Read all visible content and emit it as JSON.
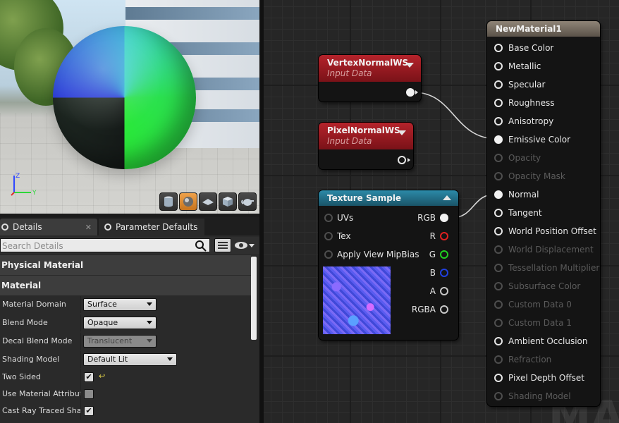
{
  "details_panel": {
    "tabs": [
      {
        "label": "Details"
      },
      {
        "label": "Parameter Defaults"
      }
    ],
    "search_placeholder": "Search Details",
    "categories": [
      "Physical Material",
      "Material"
    ],
    "properties": [
      {
        "label": "Material Domain",
        "type": "combo",
        "value": "Surface"
      },
      {
        "label": "Blend Mode",
        "type": "combo",
        "value": "Opaque"
      },
      {
        "label": "Decal Blend Mode",
        "type": "combo",
        "value": "Translucent",
        "disabled": true
      },
      {
        "label": "Shading Model",
        "type": "combo",
        "value": "Default Lit"
      },
      {
        "label": "Two Sided",
        "type": "checkbox",
        "checked": true
      },
      {
        "label": "Use Material Attributes",
        "type": "checkbox",
        "checked": false
      },
      {
        "label": "Cast Ray Traced Shadows",
        "type": "checkbox",
        "checked": true
      }
    ]
  },
  "viewport": {
    "axis_labels": {
      "z": "Z",
      "y": "Y"
    },
    "preview_buttons": [
      "cylinder-icon",
      "sphere-icon",
      "plane-icon",
      "cube-icon",
      "teapot-icon"
    ]
  },
  "graph": {
    "watermark": "MAT",
    "nodes": {
      "vertex_normal": {
        "title": "VertexNormalWS",
        "subtitle": "Input Data"
      },
      "pixel_normal": {
        "title": "PixelNormalWS",
        "subtitle": "Input Data"
      },
      "texture_sample": {
        "title": "Texture Sample",
        "inputs": [
          "UVs",
          "Tex",
          "Apply View MipBias"
        ],
        "outputs": [
          "RGB",
          "R",
          "G",
          "B",
          "A",
          "RGBA"
        ]
      },
      "material": {
        "title": "NewMaterial1",
        "inputs": [
          {
            "label": "Base Color",
            "enabled": true
          },
          {
            "label": "Metallic",
            "enabled": true
          },
          {
            "label": "Specular",
            "enabled": true
          },
          {
            "label": "Roughness",
            "enabled": true
          },
          {
            "label": "Anisotropy",
            "enabled": true
          },
          {
            "label": "Emissive Color",
            "enabled": true,
            "connected": true
          },
          {
            "label": "Opacity",
            "enabled": false
          },
          {
            "label": "Opacity Mask",
            "enabled": false
          },
          {
            "label": "Normal",
            "enabled": true,
            "connected": true
          },
          {
            "label": "Tangent",
            "enabled": true
          },
          {
            "label": "World Position Offset",
            "enabled": true
          },
          {
            "label": "World Displacement",
            "enabled": false
          },
          {
            "label": "Tessellation Multiplier",
            "enabled": false
          },
          {
            "label": "Subsurface Color",
            "enabled": false
          },
          {
            "label": "Custom Data 0",
            "enabled": false
          },
          {
            "label": "Custom Data 1",
            "enabled": false
          },
          {
            "label": "Ambient Occlusion",
            "enabled": true
          },
          {
            "label": "Refraction",
            "enabled": false
          },
          {
            "label": "Pixel Depth Offset",
            "enabled": true
          },
          {
            "label": "Shading Model",
            "enabled": false
          }
        ]
      }
    }
  },
  "colors": {
    "accent": "#e08a30",
    "pin_r": "#e02020",
    "pin_g": "#20d020",
    "pin_b": "#2040e0"
  }
}
